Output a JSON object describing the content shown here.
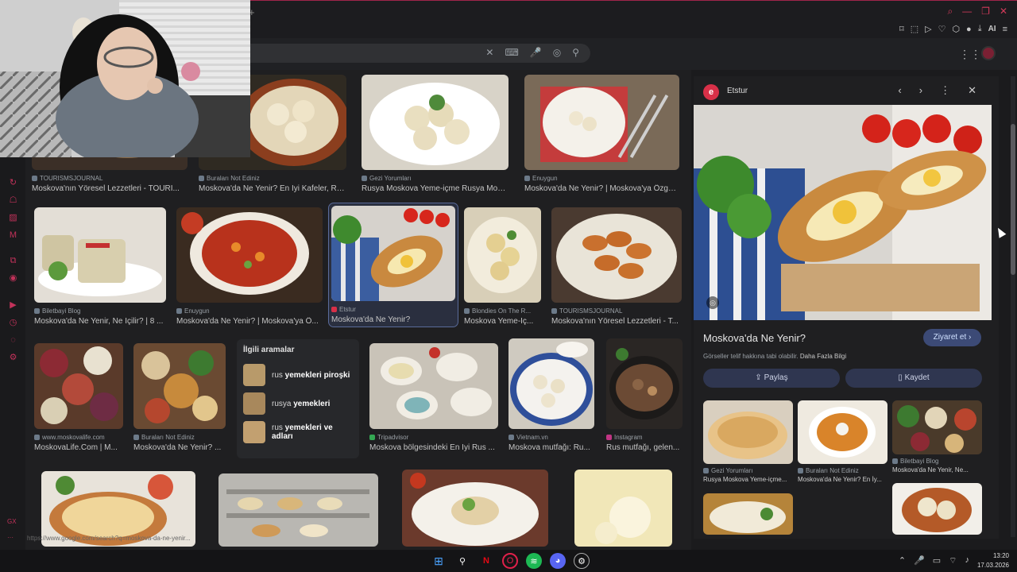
{
  "browser": {
    "new_tab_label": "+",
    "window_controls": [
      "⌕",
      "—",
      "❐",
      "✕"
    ],
    "toolbar_ai_label": "AI"
  },
  "header": {
    "search_placeholder": "",
    "clear_icon": "✕",
    "keyboard_icon": "⌨",
    "mic_icon": "🎤",
    "lens_icon": "◎",
    "search_icon": "⚲"
  },
  "results": [
    {
      "source": "TOURISMSJOURNAL",
      "caption": "Moskova'nın Yöresel Lezzetleri - TOURI..."
    },
    {
      "source": "Buraları Not Ediniz",
      "caption": "Moskova'da Ne Yenir? En İyi Kafeler, Re..."
    },
    {
      "source": "Gezi Yorumları",
      "caption": "Rusya Moskova Yeme-içme Rusya Mosk..."
    },
    {
      "source": "Enuygun",
      "caption": "Moskova'da Ne Yenir? | Moskova'ya Özgü ..."
    },
    {
      "source": "Biletbayi Blog",
      "caption": "Moskova'da Ne Yenir, Ne İçilir? | 8 ..."
    },
    {
      "source": "Enuygun",
      "caption": "Moskova'da Ne Yenir? | Moskova'ya Ö..."
    },
    {
      "source": "Etstur",
      "caption": "Moskova'da Ne Yenir?"
    },
    {
      "source": "Blondies On The R...",
      "caption": "Moskova Yeme-İç..."
    },
    {
      "source": "TOURISMSJOURNAL",
      "caption": "Moskova'nın Yöresel Lezzetleri - T..."
    },
    {
      "source": "www.moskovalife.com",
      "caption": "MoskovaLife.Com | M..."
    },
    {
      "source": "Buraları Not Ediniz",
      "caption": "Moskova'da Ne Yenir? ..."
    },
    {
      "source": "Tripadvisor",
      "caption": "Moskova bölgesindeki En İyi Rus ..."
    },
    {
      "source": "Vietnam.vn",
      "caption": "Moskova mutfağı: Ru..."
    },
    {
      "source": "Instagram",
      "caption": "Rus mutfağı, gelen..."
    }
  ],
  "related": {
    "title": "İlgili aramalar",
    "items": [
      {
        "prefix": "rus ",
        "bold": "yemekleri piroşki"
      },
      {
        "prefix": "rusya ",
        "bold": "yemekleri"
      },
      {
        "prefix": "rus ",
        "bold": "yemekleri ve adları"
      }
    ]
  },
  "status_url": "https://www.google.com/search?q=moskova-da-ne-yenir...",
  "panel": {
    "logo_letter": "e",
    "site": "Etstur",
    "prev_icon": "‹",
    "next_icon": "›",
    "more_icon": "⋮",
    "close_icon": "✕",
    "lens_icon": "◎",
    "title": "Moskova'da Ne Yenir?",
    "visit_label": "Ziyaret et ›",
    "copyright": "Görseller telif hakkına tabi olabilir.",
    "learn_more": "Daha Fazla Bilgi",
    "share_label": "Paylaş",
    "save_label": "Kaydet",
    "similar": [
      {
        "source": "Gezi Yorumları",
        "caption": "Rusya Moskova Yeme-içme..."
      },
      {
        "source": "Buraları Not Ediniz",
        "caption": "Moskova'da Ne Yenir? En İy..."
      },
      {
        "source": "Biletbayi Blog",
        "caption": "Moskova'da Ne Yenir, Ne..."
      }
    ]
  },
  "taskbar": {
    "time": "13:20",
    "date": "17.03.2026"
  },
  "colors": {
    "accent": "#d23a5a",
    "selected_outline": "#5a6b9a",
    "visit_button": "#3c4a76"
  }
}
